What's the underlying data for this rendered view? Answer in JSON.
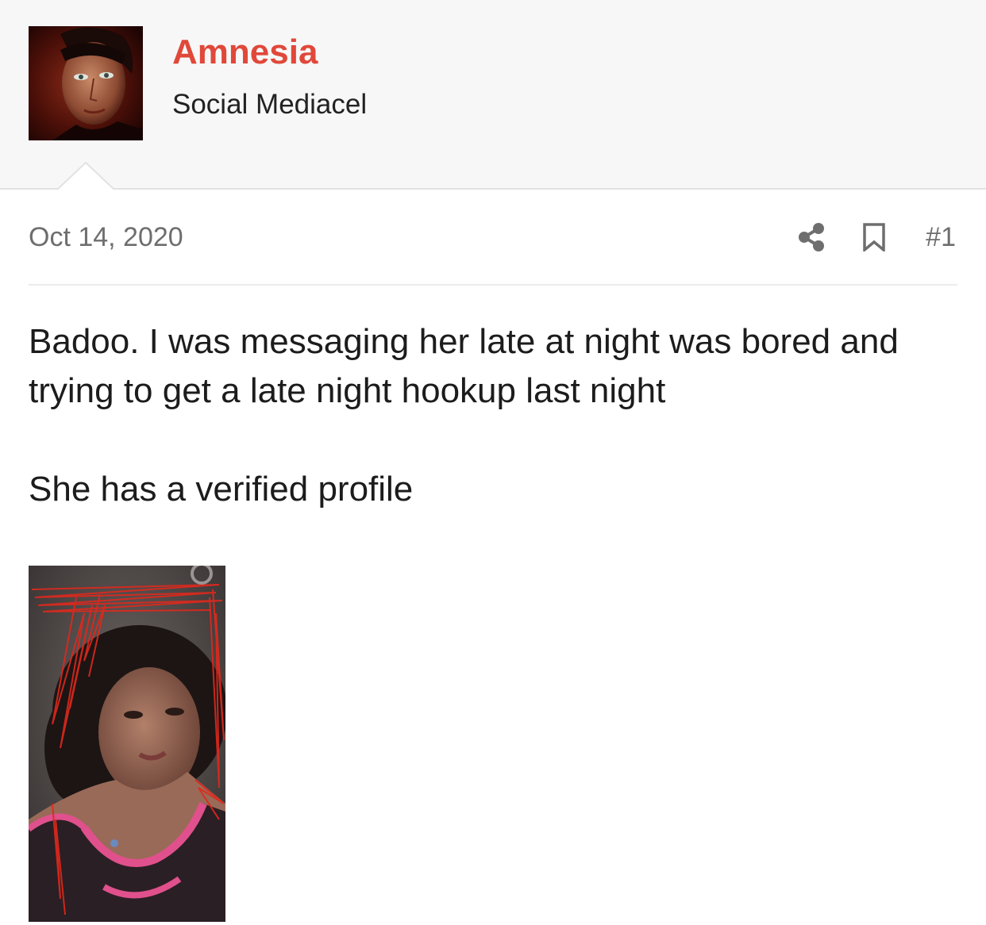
{
  "user": {
    "name": "Amnesia",
    "title": "Social Mediacel",
    "name_color": "#e0483a"
  },
  "post": {
    "date": "Oct 14, 2020",
    "number": "#1",
    "paragraphs": [
      "Badoo. I was messaging her late at night was bored and trying to get a late night hookup last night",
      "She has a verified profile"
    ]
  },
  "icons": {
    "share": "share-icon",
    "bookmark": "bookmark-icon"
  }
}
